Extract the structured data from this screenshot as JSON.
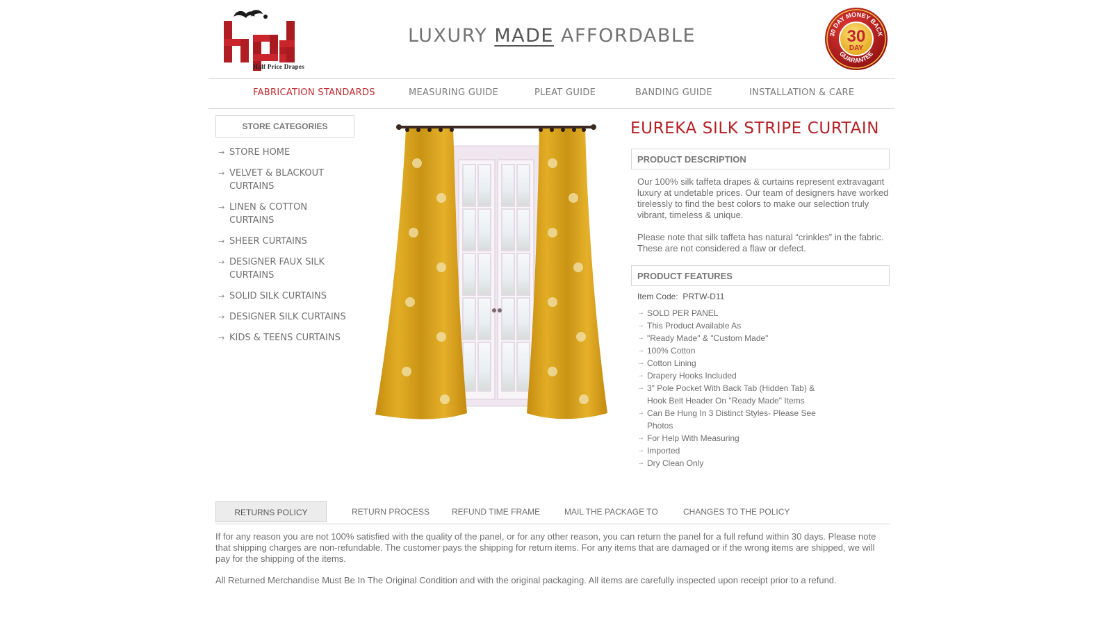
{
  "header": {
    "logo_text": "hpd",
    "logo_sub": "Half Price Drapes",
    "tagline_before": "LUXURY",
    "tagline_made": "MADE",
    "tagline_after": "AFFORDABLE",
    "badge_top": "30 DAY MONEY BACK",
    "badge_number": "30",
    "badge_day": "DAY",
    "badge_bottom": "GUARANTEE"
  },
  "nav": [
    {
      "label": "FABRICATION STANDARDS",
      "active": true
    },
    {
      "label": "MEASURING GUIDE"
    },
    {
      "label": "PLEAT GUIDE"
    },
    {
      "label": "BANDING GUIDE"
    },
    {
      "label": "INSTALLATION & CARE"
    }
  ],
  "sidebar": {
    "title": "STORE CATEGORIES",
    "items": [
      "STORE HOME",
      "VELVET & BLACKOUT CURTAINS",
      "LINEN & COTTON CURTAINS",
      "SHEER CURTAINS",
      "DESIGNER FAUX SILK CURTAINS",
      "SOLID SILK CURTAINS",
      "DESIGNER SILK CURTAINS",
      "KIDS & TEENS CURTAINS"
    ]
  },
  "product": {
    "title": "EUREKA SILK STRIPE CURTAIN",
    "desc_heading": "PRODUCT DESCRIPTION",
    "desc_p1": "Our 100% silk taffeta drapes & curtains represent extravagant luxury at undetable prices. Our team of designers have worked tirelessly to find the best colors to make our selection truly vibrant, timeless & unique.",
    "desc_p2": "Please note that silk taffeta has natural “crinkles” in the fabric. These are not considered a flaw or defect.",
    "features_heading": "PRODUCT FEATURES",
    "item_code_label": "Item Code:",
    "item_code": "PRTW-D11",
    "features": [
      "SOLD PER PANEL",
      "This Product Available As",
      "\"Ready Made\" & \"Custom Made\"",
      "100% Cotton",
      "Cotton Lining",
      "Drapery Hooks Included",
      "3\" Pole Pocket With Back Tab (Hidden Tab) & Hook Belt Header On \"Ready Made\" Items",
      "Can Be Hung In 3 Distinct Styles- Please See Photos",
      "For Help With Measuring",
      "Imported",
      "Dry Clean Only"
    ]
  },
  "tabs": [
    {
      "label": "RETURNS POLICY",
      "active": true
    },
    {
      "label": "RETURN PROCESS"
    },
    {
      "label": "REFUND TIME FRAME"
    },
    {
      "label": "MAIL THE PACKAGE TO"
    },
    {
      "label": "CHANGES TO THE POLICY"
    }
  ],
  "policy": {
    "p1": "If for any reason you are not 100% satisfied with the quality of the panel, or for any other reason, you can return the panel for a full refund within 30 days. Please note that shipping charges are non-refundable. The customer pays the shipping for return items. For any items that are damaged or if the wrong items are shipped, we will pay for the shipping of the items.",
    "p2": "All Returned Merchandise Must Be In The Original Condition and with the original packaging. All items are carefully inspected upon receipt prior to a refund."
  },
  "colors": {
    "accent_red": "#c0282d",
    "title_red": "#b52025",
    "curtain_gold": "#d9a21b",
    "text_gray": "#6e6e6e"
  }
}
